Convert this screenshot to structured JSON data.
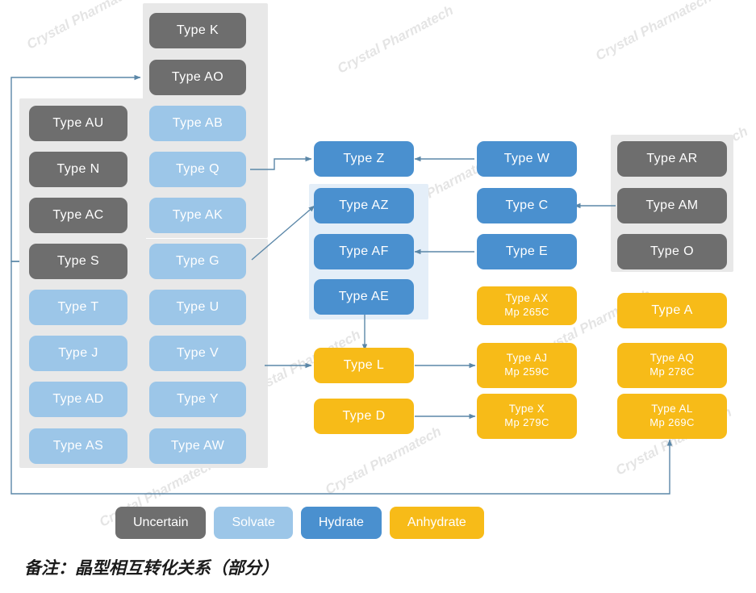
{
  "diagram": {
    "footer_note": "备注：晶型相互转化关系（部分）",
    "watermark_text": "Crystal Pharmatech",
    "colors": {
      "uncertain": "#6e6e6e",
      "solvate": "#9cc6e8",
      "hydrate": "#4a90cf",
      "anhydrate": "#f7bb18",
      "panel_grey": "#e8e8e8",
      "panel_lightblue": "#e4eef8",
      "connector": "#5b87a8",
      "background": "#ffffff"
    }
  },
  "legend": {
    "items": [
      {
        "label": "Uncertain",
        "kind": "uncertain"
      },
      {
        "label": "Solvate",
        "kind": "solvate"
      },
      {
        "label": "Hydrate",
        "kind": "hydrate"
      },
      {
        "label": "Anhydrate",
        "kind": "anhydrate"
      }
    ]
  },
  "nodes": {
    "k": {
      "label": "Type K",
      "mp": "",
      "kind": "uncertain"
    },
    "ao": {
      "label": "Type AO",
      "mp": "",
      "kind": "uncertain"
    },
    "ab": {
      "label": "Type AB",
      "mp": "",
      "kind": "solvate"
    },
    "q": {
      "label": "Type Q",
      "mp": "",
      "kind": "solvate"
    },
    "ak": {
      "label": "Type AK",
      "mp": "",
      "kind": "solvate"
    },
    "g": {
      "label": "Type G",
      "mp": "",
      "kind": "solvate"
    },
    "u": {
      "label": "Type U",
      "mp": "",
      "kind": "solvate"
    },
    "v": {
      "label": "Type V",
      "mp": "",
      "kind": "solvate"
    },
    "y": {
      "label": "Type Y",
      "mp": "",
      "kind": "solvate"
    },
    "aw": {
      "label": "Type AW",
      "mp": "",
      "kind": "solvate"
    },
    "au": {
      "label": "Type AU",
      "mp": "",
      "kind": "uncertain"
    },
    "n": {
      "label": "Type N",
      "mp": "",
      "kind": "uncertain"
    },
    "ac": {
      "label": "Type AC",
      "mp": "",
      "kind": "uncertain"
    },
    "s": {
      "label": "Type S",
      "mp": "",
      "kind": "uncertain"
    },
    "t": {
      "label": "Type T",
      "mp": "",
      "kind": "solvate"
    },
    "j": {
      "label": "Type J",
      "mp": "",
      "kind": "solvate"
    },
    "ad": {
      "label": "Type AD",
      "mp": "",
      "kind": "solvate"
    },
    "as": {
      "label": "Type AS",
      "mp": "",
      "kind": "solvate"
    },
    "z": {
      "label": "Type Z",
      "mp": "",
      "kind": "hydrate"
    },
    "az": {
      "label": "Type AZ",
      "mp": "",
      "kind": "hydrate"
    },
    "af": {
      "label": "Type AF",
      "mp": "",
      "kind": "hydrate"
    },
    "ae": {
      "label": "Type AE",
      "mp": "",
      "kind": "hydrate"
    },
    "l": {
      "label": "Type L",
      "mp": "",
      "kind": "anhydrate"
    },
    "d": {
      "label": "Type D",
      "mp": "",
      "kind": "anhydrate"
    },
    "w": {
      "label": "Type W",
      "mp": "",
      "kind": "hydrate"
    },
    "c": {
      "label": "Type C",
      "mp": "",
      "kind": "hydrate"
    },
    "e": {
      "label": "Type E",
      "mp": "",
      "kind": "hydrate"
    },
    "ax": {
      "label": "Type AX",
      "mp": "Mp 265C",
      "kind": "anhydrate"
    },
    "aj": {
      "label": "Type AJ",
      "mp": "Mp 259C",
      "kind": "anhydrate"
    },
    "x": {
      "label": "Type X",
      "mp": "Mp 279C",
      "kind": "anhydrate"
    },
    "ar": {
      "label": "Type AR",
      "mp": "",
      "kind": "uncertain"
    },
    "am": {
      "label": "Type AM",
      "mp": "",
      "kind": "uncertain"
    },
    "o": {
      "label": "Type O",
      "mp": "",
      "kind": "uncertain"
    },
    "a": {
      "label": "Type A",
      "mp": "",
      "kind": "anhydrate"
    },
    "aq": {
      "label": "Type AQ",
      "mp": "Mp 278C",
      "kind": "anhydrate"
    },
    "al": {
      "label": "Type AL",
      "mp": "Mp 269C",
      "kind": "anhydrate"
    }
  },
  "edges": [
    {
      "from": "s",
      "to": "ao",
      "name": "edge-s-to-ao"
    },
    {
      "from": "q",
      "to": "z",
      "name": "edge-q-to-z"
    },
    {
      "from": "g",
      "to": "az",
      "name": "edge-g-to-az"
    },
    {
      "from": "w",
      "to": "z",
      "name": "edge-w-to-z"
    },
    {
      "from": "am",
      "to": "c",
      "name": "edge-am-to-c"
    },
    {
      "from": "e",
      "to": "af",
      "name": "edge-e-to-af"
    },
    {
      "from": "ae",
      "to": "l",
      "name": "edge-ae-to-l"
    },
    {
      "from": "v",
      "to": "l",
      "name": "edge-v-to-l"
    },
    {
      "from": "l",
      "to": "aj",
      "name": "edge-l-to-aj"
    },
    {
      "from": "d",
      "to": "x",
      "name": "edge-d-to-x"
    },
    {
      "from": "s",
      "to": "al",
      "name": "edge-s-to-al"
    }
  ]
}
